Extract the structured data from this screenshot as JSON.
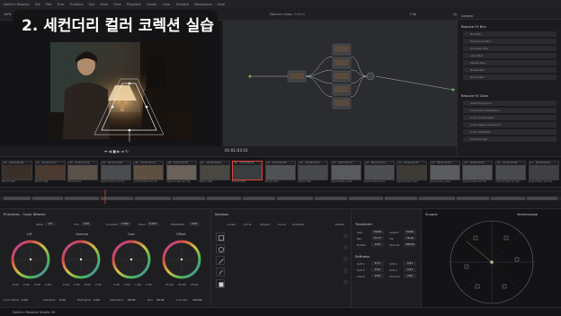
{
  "menu": {
    "app_name": "DaVinci Resolve",
    "items": [
      "File",
      "Edit",
      "Trim",
      "Timeline",
      "Clip",
      "Mark",
      "View",
      "Playback",
      "Fusion",
      "Color",
      "Fairlight",
      "Workspace",
      "Help"
    ]
  },
  "toolbar": {
    "project_name": "Davinci class",
    "project_status": "Edited",
    "left_label": "16%",
    "clip_label": "Clip",
    "right_items": [
      "Quick Export",
      "Timeline",
      "Nodes",
      "Effects",
      "Lightbox"
    ]
  },
  "overlay": {
    "title": "2. 세컨더리 컬러 코렉션 실습"
  },
  "viewer": {
    "timecode": "01:01:03:10"
  },
  "library": {
    "tab": "Library",
    "header_fx": "Resolve FX Blur",
    "fx_items": [
      "Box Blur",
      "Directional Blur",
      "Gaussian Blur",
      "Lens Blur",
      "Mosaic Blur",
      "Radial Blur",
      "Zoom Blur"
    ],
    "header_color": "Resolve FX Color",
    "color_items": [
      "ACES Transform",
      "Chromatic Adaptation",
      "Color Compressor",
      "Color Space Transform",
      "Color Stabilizer",
      "Contrast Pop"
    ]
  },
  "nodes": {
    "labels": [
      "01",
      "02",
      "03",
      "04",
      "05",
      "06",
      "07"
    ]
  },
  "clips": [
    {
      "num": "01",
      "tc": "00:00:00:00",
      "label": "Effort5 HDR"
    },
    {
      "num": "02",
      "tc": "01:01:20:13",
      "label": "Effort5 HDR"
    },
    {
      "num": "03",
      "tc": "07:02:47:14",
      "label": "Effort4 HDR"
    },
    {
      "num": "04",
      "tc": "01:02:11:09",
      "label": "Apple ProRes 422 HQ"
    },
    {
      "num": "05",
      "tc": "07:24:33:14",
      "label": "Apple ProRes 422 HQ"
    },
    {
      "num": "06",
      "tc": "04:51:15:05",
      "label": "Apple ProRes 422 HQ"
    },
    {
      "num": "07",
      "tc": "00:00:00:00",
      "label": "Effort4 HDR"
    },
    {
      "num": "08",
      "tc": "00:00:00:00",
      "label": "Effort4 HDR"
    },
    {
      "num": "09",
      "tc": "00:00:00:00",
      "label": "Effort4 HDR"
    },
    {
      "num": "10",
      "tc": "00:00:00:00",
      "label": "Effort4 HDR"
    },
    {
      "num": "11",
      "tc": "00:07:03:15",
      "label": "Apple ProRes 4444"
    },
    {
      "num": "12",
      "tc": "00:07:00:13",
      "label": "Apple ProRes 4444"
    },
    {
      "num": "13",
      "tc": "00:00:07:22",
      "label": "Apple ProRes 4444"
    },
    {
      "num": "14",
      "tc": "00:05:40:05",
      "label": "Apple ProRes 4444"
    },
    {
      "num": "15",
      "tc": "00:00:00:00",
      "label": "Apple ProRes 422 HQ"
    },
    {
      "num": "16",
      "tc": "05:39:14:06",
      "label": "Apple ProRes 422 HQ"
    },
    {
      "num": "17",
      "tc": "00:00:00:00",
      "label": "Apple ProRes 422 HQ"
    }
  ],
  "primaries": {
    "title": "Primaries - Color Wheels",
    "temp_label": "Temp",
    "temp_value": "0.0",
    "tint_label": "Tint",
    "tint_value": "0.00",
    "contrast_label": "Contrast",
    "contrast_value": "1.000",
    "pivot_label": "Pivot",
    "pivot_value": "0.435",
    "middetail_label": "Mid/Detail",
    "middetail_value": "0.00",
    "wheels": [
      {
        "name": "Lift",
        "values": [
          "0.00",
          "0.00",
          "0.00",
          "0.00"
        ]
      },
      {
        "name": "Gamma",
        "values": [
          "0.00",
          "0.00",
          "0.00",
          "0.00"
        ]
      },
      {
        "name": "Gain",
        "values": [
          "1.00",
          "1.00",
          "1.00",
          "1.00"
        ]
      },
      {
        "name": "Offset",
        "values": [
          "25.00",
          "25.00",
          "25.00"
        ]
      }
    ],
    "footer": [
      {
        "label": "Color Boost",
        "value": "0.00"
      },
      {
        "label": "Shadows",
        "value": "0.00"
      },
      {
        "label": "Highlights",
        "value": "0.00"
      },
      {
        "label": "Saturation",
        "value": "50.00"
      },
      {
        "label": "Hue",
        "value": "50.00"
      },
      {
        "label": "Lum Mix",
        "value": "100.00"
      }
    ]
  },
  "window": {
    "title": "Window",
    "tools": [
      "Linear",
      "Circle",
      "Polygon",
      "Curve",
      "Gradient"
    ],
    "delete_label": "Delete"
  },
  "transform": {
    "title": "Transform",
    "rows": [
      {
        "l1": "Size",
        "v1": "50.00",
        "l2": "Aspect",
        "v2": "50.00"
      },
      {
        "l1": "Pan",
        "v1": "57.77",
        "l2": "Tilt",
        "v2": "76.10"
      },
      {
        "l1": "Rotate",
        "v1": "0.00",
        "l2": "Opacity",
        "v2": "100.00"
      }
    ],
    "softness_title": "Softness",
    "soft_rows": [
      {
        "l1": "Soft 1",
        "v1": "8.71",
        "l2": "Soft 2",
        "v2": "0.41"
      },
      {
        "l1": "Soft 3",
        "v1": "0.41",
        "l2": "Soft 4",
        "v2": "0.41"
      },
      {
        "l1": "Inside",
        "v1": "0.00",
        "l2": "Outside",
        "v2": "0.00"
      }
    ]
  },
  "scopes": {
    "title": "Scopes",
    "mode": "Vectorscope"
  },
  "status": {
    "app_label": "DaVinci Resolve Studio 18"
  }
}
